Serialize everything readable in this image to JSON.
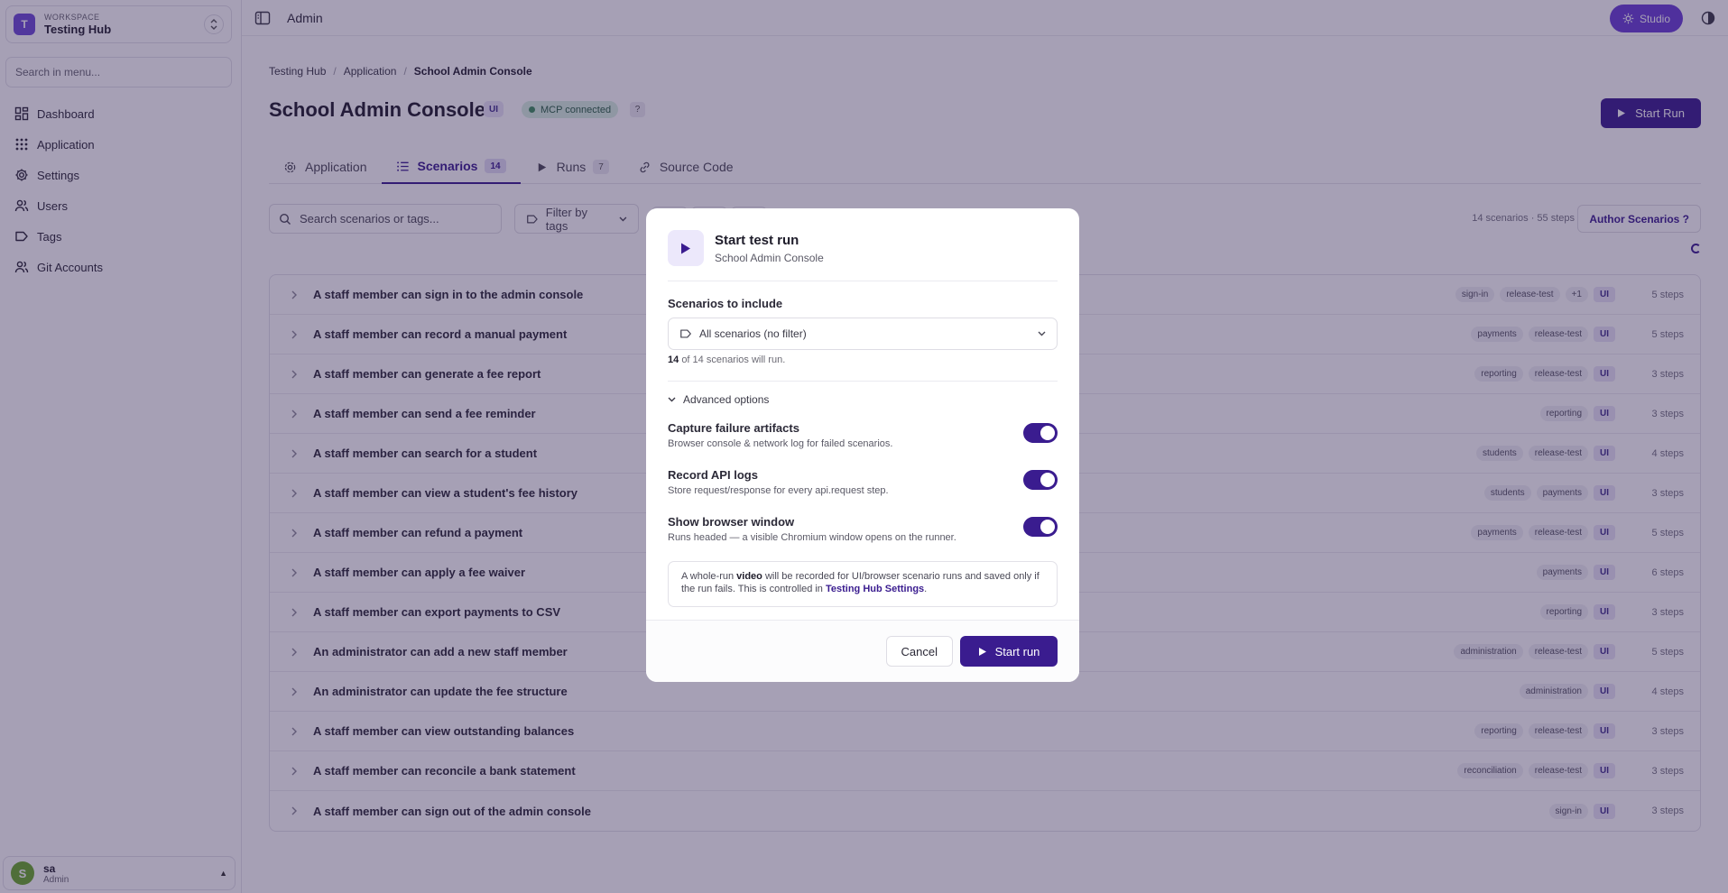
{
  "sidebar": {
    "workspace_label": "WORKSPACE",
    "workspace_name": "Testing Hub",
    "workspace_initial": "T",
    "search_placeholder": "Search in menu...",
    "items": [
      {
        "label": "Dashboard",
        "icon": "dashboard-icon"
      },
      {
        "label": "Application",
        "icon": "grid-icon"
      },
      {
        "label": "Settings",
        "icon": "gear-icon"
      },
      {
        "label": "Users",
        "icon": "users-icon"
      },
      {
        "label": "Tags",
        "icon": "tag-icon"
      },
      {
        "label": "Git Accounts",
        "icon": "users-icon"
      }
    ],
    "user": {
      "initial": "S",
      "name": "sa",
      "role": "Admin"
    }
  },
  "topbar": {
    "title": "Admin",
    "studio_label": "Studio"
  },
  "breadcrumb": [
    "Testing Hub",
    "Application",
    "School Admin Console"
  ],
  "page": {
    "title": "School Admin Console",
    "type_badge": "UI",
    "mcp_status": "MCP connected",
    "help": "?",
    "start_run_label": "Start Run"
  },
  "tabs": [
    {
      "label": "Application",
      "count": ""
    },
    {
      "label": "Scenarios",
      "count": "14"
    },
    {
      "label": "Runs",
      "count": "7"
    },
    {
      "label": "Source Code",
      "count": ""
    }
  ],
  "toolbar": {
    "search_placeholder": "Search scenarios or tags...",
    "filter_label": "Filter by tags",
    "summary": "14 scenarios · 55 steps",
    "author_label": "Author Scenarios ?"
  },
  "scenarios": [
    {
      "title": "A staff member can sign in to the admin console",
      "tags": [
        "sign-in",
        "release-test",
        "+1"
      ],
      "type": "UI",
      "steps": "5 steps"
    },
    {
      "title": "A staff member can record a manual payment",
      "tags": [
        "payments",
        "release-test"
      ],
      "type": "UI",
      "steps": "5 steps"
    },
    {
      "title": "A staff member can generate a fee report",
      "tags": [
        "reporting",
        "release-test"
      ],
      "type": "UI",
      "steps": "3 steps"
    },
    {
      "title": "A staff member can send a fee reminder",
      "tags": [
        "reporting"
      ],
      "type": "UI",
      "steps": "3 steps"
    },
    {
      "title": "A staff member can search for a student",
      "tags": [
        "students",
        "release-test"
      ],
      "type": "UI",
      "steps": "4 steps"
    },
    {
      "title": "A staff member can view a student's fee history",
      "tags": [
        "students",
        "payments"
      ],
      "type": "UI",
      "steps": "3 steps"
    },
    {
      "title": "A staff member can refund a payment",
      "tags": [
        "payments",
        "release-test"
      ],
      "type": "UI",
      "steps": "5 steps"
    },
    {
      "title": "A staff member can apply a fee waiver",
      "tags": [
        "payments"
      ],
      "type": "UI",
      "steps": "6 steps"
    },
    {
      "title": "A staff member can export payments to CSV",
      "tags": [
        "reporting"
      ],
      "type": "UI",
      "steps": "3 steps"
    },
    {
      "title": "An administrator can add a new staff member",
      "tags": [
        "administration",
        "release-test"
      ],
      "type": "UI",
      "steps": "5 steps"
    },
    {
      "title": "An administrator can update the fee structure",
      "tags": [
        "administration"
      ],
      "type": "UI",
      "steps": "4 steps"
    },
    {
      "title": "A staff member can view outstanding balances",
      "tags": [
        "reporting",
        "release-test"
      ],
      "type": "UI",
      "steps": "3 steps"
    },
    {
      "title": "A staff member can reconcile a bank statement",
      "tags": [
        "reconciliation",
        "release-test"
      ],
      "type": "UI",
      "steps": "3 steps"
    },
    {
      "title": "A staff member can sign out of the admin console",
      "tags": [
        "sign-in"
      ],
      "type": "UI",
      "steps": "3 steps"
    }
  ],
  "modal": {
    "title": "Start test run",
    "subtitle": "School Admin Console",
    "scenarios_label": "Scenarios to include",
    "filter_value": "All scenarios (no filter)",
    "count_bold": "14",
    "count_rest": "of 14 scenarios will run.",
    "advanced_label": "Advanced options",
    "options": [
      {
        "title": "Capture failure artifacts",
        "desc": "Browser console & network log for failed scenarios.",
        "enabled": true
      },
      {
        "title": "Record API logs",
        "desc": "Store request/response for every api.request step.",
        "enabled": true
      },
      {
        "title": "Show browser window",
        "desc": "Runs headed — a visible Chromium window opens on the runner.",
        "enabled": true
      }
    ],
    "notice": {
      "pre": "A whole-run ",
      "bold": "video",
      "mid": " will be recorded for UI/browser scenario runs and saved only if the run fails. This is controlled in ",
      "link": "Testing Hub Settings",
      "post": "."
    },
    "cancel_label": "Cancel",
    "start_label": "Start run"
  },
  "colors": {
    "accent": "#3a1c8f",
    "studio": "#6a3fd6",
    "overlay": "#2a1c4e"
  }
}
